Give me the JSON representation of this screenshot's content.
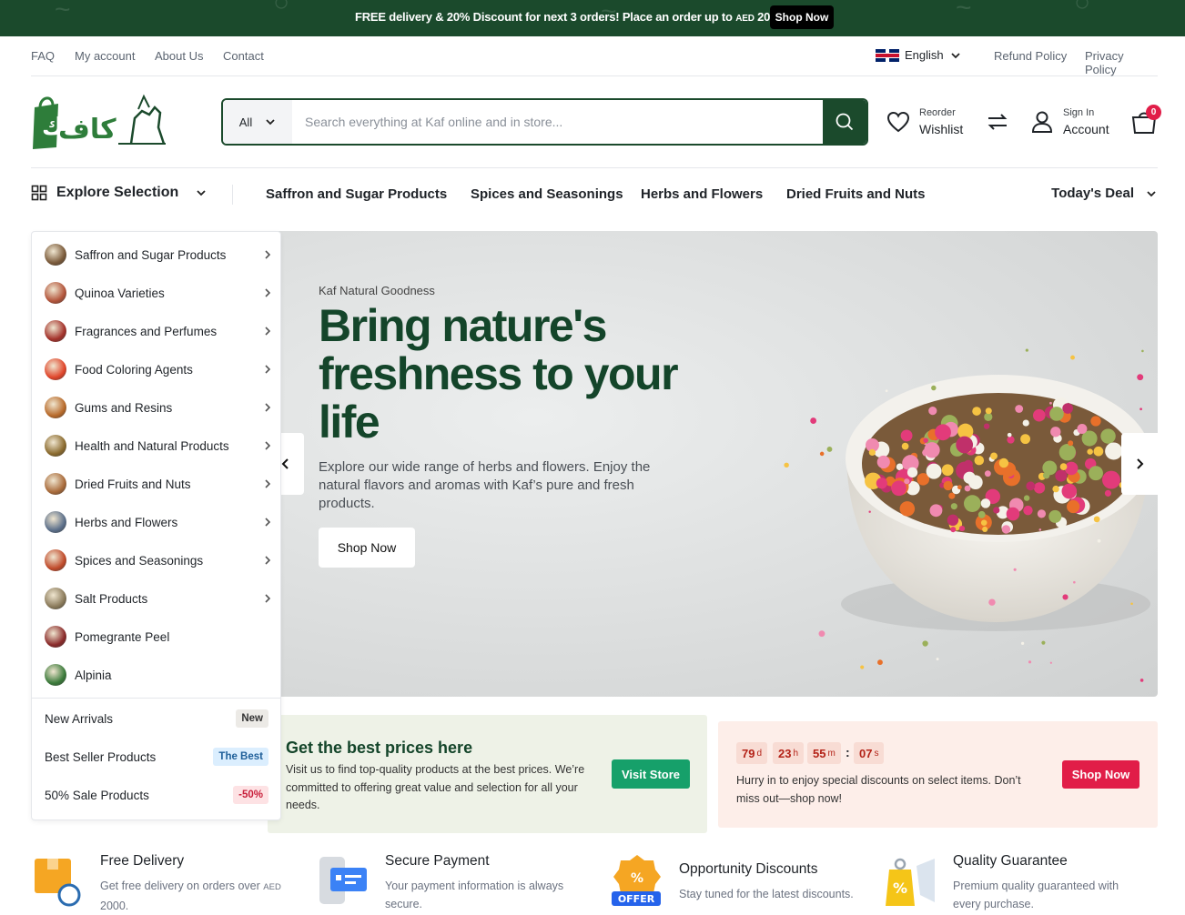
{
  "announcement": {
    "text": "FREE delivery & 20% Discount for next 3 orders! Place an order up to",
    "currency": "AED",
    "amount": "2000.",
    "button": "Shop Now"
  },
  "utility_nav": {
    "links": [
      "FAQ",
      "My account",
      "About Us",
      "Contact"
    ],
    "language": "English",
    "policies": [
      "Refund Policy",
      "Privacy Policy"
    ]
  },
  "header": {
    "search": {
      "category": "All",
      "placeholder": "Search everything at Kaf online and in store..."
    },
    "wishlist": {
      "line1": "Reorder",
      "line2": "Wishlist"
    },
    "account": {
      "line1": "Sign In",
      "line2": "Account"
    },
    "cart_count": "0"
  },
  "category_nav": {
    "explore": "Explore Selection",
    "links": [
      "Saffron and Sugar Products",
      "Spices and Seasonings",
      "Herbs and Flowers",
      "Dried Fruits and Nuts"
    ],
    "deal": "Today's Deal"
  },
  "sidebar": {
    "categories": [
      {
        "label": "Saffron and Sugar Products",
        "has_sub": true,
        "color": "#7a5a3a"
      },
      {
        "label": "Quinoa Varieties",
        "has_sub": true,
        "color": "#b2543a"
      },
      {
        "label": "Fragrances and Perfumes",
        "has_sub": true,
        "color": "#a3312a"
      },
      {
        "label": "Food Coloring Agents",
        "has_sub": true,
        "color": "#e0452a"
      },
      {
        "label": "Gums and Resins",
        "has_sub": true,
        "color": "#b86a2a"
      },
      {
        "label": "Health and Natural Products",
        "has_sub": true,
        "color": "#8a6a2e"
      },
      {
        "label": "Dried Fruits and Nuts",
        "has_sub": true,
        "color": "#a86a3a"
      },
      {
        "label": "Herbs and Flowers",
        "has_sub": true,
        "color": "#5b6f8a"
      },
      {
        "label": "Spices and Seasonings",
        "has_sub": true,
        "color": "#c04a2a"
      },
      {
        "label": "Salt Products",
        "has_sub": true,
        "color": "#8a7a5a"
      },
      {
        "label": "Pomegrante Peel",
        "has_sub": false,
        "color": "#8a2a2a"
      },
      {
        "label": "Alpinia",
        "has_sub": false,
        "color": "#3a7a3a"
      }
    ],
    "extras": [
      {
        "label": "New Arrivals",
        "tag": "New",
        "tag_bg": "#eceae6",
        "tag_color": "#333333"
      },
      {
        "label": "Best Seller Products",
        "tag": "The Best",
        "tag_bg": "#dbeefe",
        "tag_color": "#1f5f99"
      },
      {
        "label": "50% Sale Products",
        "tag": "-50%",
        "tag_bg": "#fde2e4",
        "tag_color": "#c81e3a"
      }
    ]
  },
  "hero": {
    "kicker": "Kaf Natural Goodness",
    "headline": "Bring nature's freshness to your life",
    "description": "Explore our wide range of herbs and flowers. Enjoy the natural flavors and aromas with Kaf’s pure and fresh products.",
    "button": "Shop Now"
  },
  "promo_store": {
    "title": "Get the best prices here",
    "text": "Visit us to find top-quality products at the best prices. We’re committed to offering great value and selection for all your needs.",
    "button": "Visit Store"
  },
  "promo_deal": {
    "countdown": [
      {
        "value": "79",
        "unit": "d"
      },
      {
        "value": "23",
        "unit": "h"
      },
      {
        "value": "55",
        "unit": "m"
      },
      {
        "value": "07",
        "unit": "s"
      }
    ],
    "text": "Hurry in to enjoy special discounts on select items. Don’t miss out—shop now!",
    "button": "Shop Now"
  },
  "features": [
    {
      "title": "Free Delivery",
      "text": "Get free delivery on orders over",
      "currency": "AED",
      "amount": "2000.",
      "icon": "delivery-box-icon"
    },
    {
      "title": "Secure Payment",
      "text": "Your payment information is always secure.",
      "icon": "secure-card-icon"
    },
    {
      "title": "Opportunity Discounts",
      "text": "Stay tuned for the latest discounts.",
      "badge": "OFFER",
      "icon": "offer-badge-icon"
    },
    {
      "title": "Quality Guarantee",
      "text": "Premium quality guaranteed with every purchase.",
      "icon": "quality-tag-icon"
    }
  ],
  "colors": {
    "brand_green": "#1b4a2c",
    "accent_green": "#16a06a",
    "accent_red": "#e11d48"
  }
}
